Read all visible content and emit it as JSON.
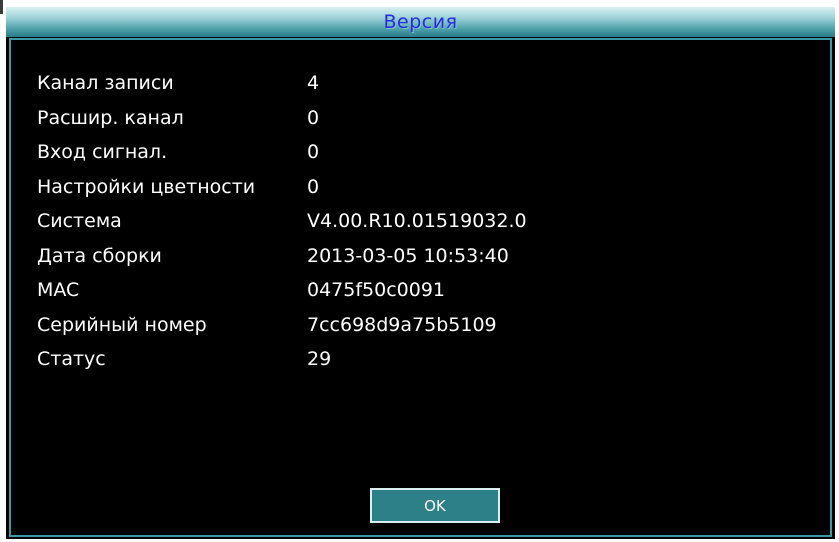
{
  "window": {
    "title": "Версия"
  },
  "info": [
    {
      "label": "Канал записи",
      "value": "4"
    },
    {
      "label": "Расшир. канал",
      "value": "0"
    },
    {
      "label": "Вход сигнал.",
      "value": "0"
    },
    {
      "label": "Настройки цветности",
      "value": "0"
    },
    {
      "label": "Система",
      "value": "V4.00.R10.01519032.0"
    },
    {
      "label": "Дата сборки",
      "value": "2013-03-05 10:53:40"
    },
    {
      "label": "MAC",
      "value": "0475f50c0091"
    },
    {
      "label": "Серийный номер",
      "value": "7cc698d9a75b5109"
    },
    {
      "label": "Статус",
      "value": "29"
    }
  ],
  "buttons": {
    "ok_label": "OK"
  },
  "colors": {
    "background": "#000000",
    "title_gradient_top": "#d9f0f2",
    "title_gradient_bottom": "#2a7c86",
    "title_text": "#2a2ce0",
    "panel_border": "#3b9aa4",
    "button_fill": "#2d7f88",
    "text": "#ffffff"
  }
}
